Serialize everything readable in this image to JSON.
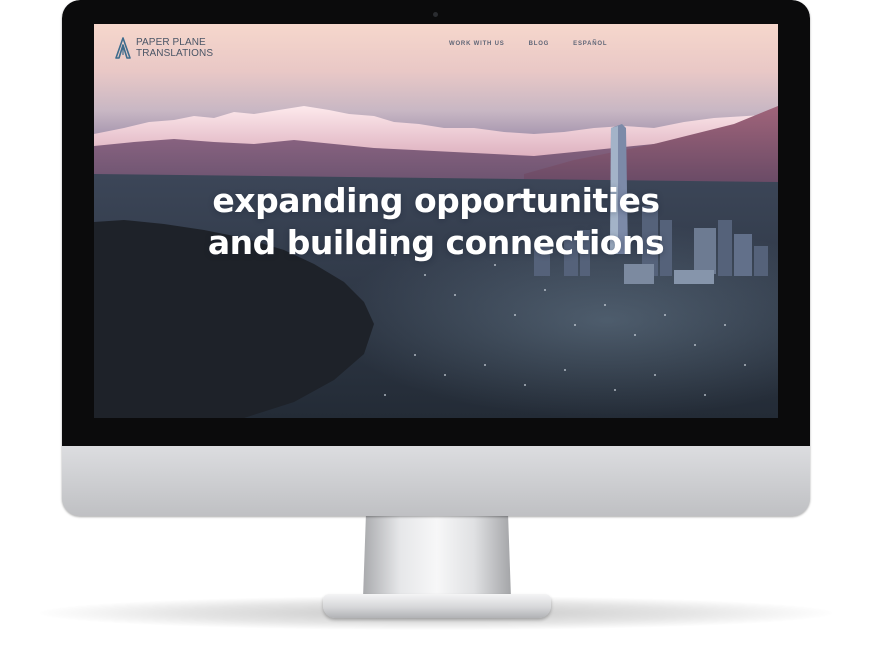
{
  "brand": {
    "line1": "PAPER PLANE",
    "line2": "TRANSLATIONS",
    "logo_icon": "paper-plane-a-icon",
    "color": "#4a5566"
  },
  "nav": {
    "items": [
      {
        "label": "WORK WITH US"
      },
      {
        "label": "BLOG"
      },
      {
        "label": "ESPAÑOL"
      }
    ]
  },
  "hero": {
    "line1": "expanding opportunities",
    "line2": "and building connections",
    "text_color": "#ffffff",
    "background": "mountains-over-city-at-dusk"
  }
}
